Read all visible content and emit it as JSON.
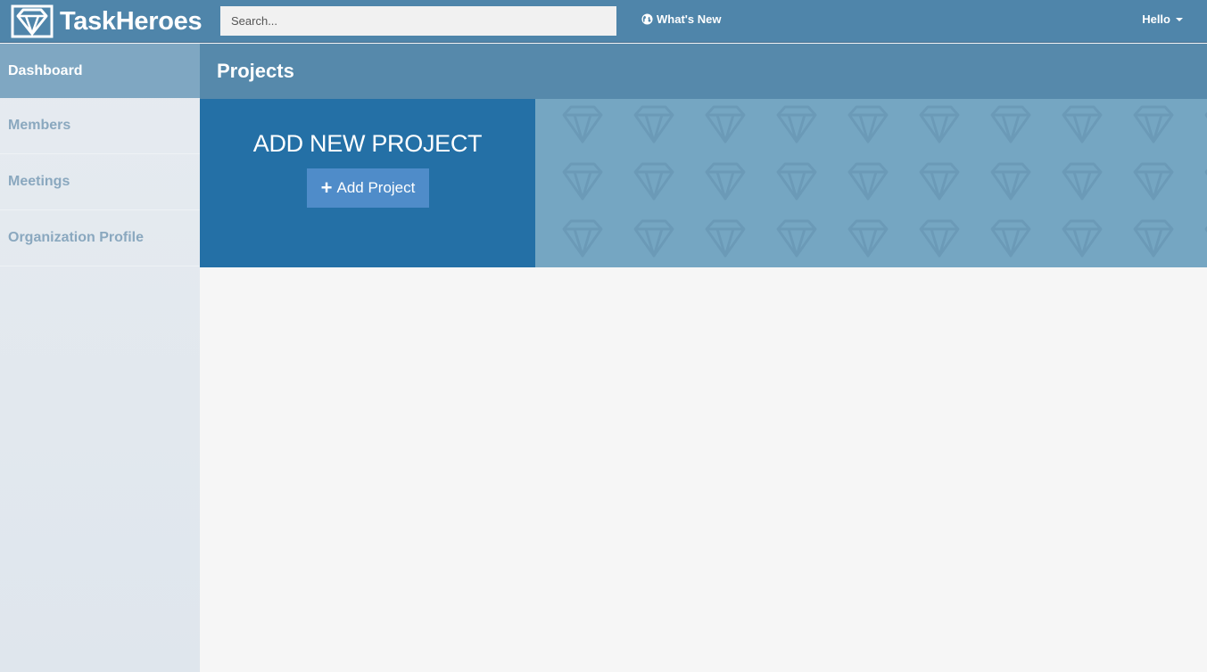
{
  "app": {
    "name": "TaskHeroes"
  },
  "header": {
    "search_placeholder": "Search...",
    "whats_new_label": "What's New",
    "user_label": "Hello"
  },
  "sidebar": {
    "items": [
      {
        "label": "Dashboard",
        "active": true
      },
      {
        "label": "Members",
        "active": false
      },
      {
        "label": "Meetings",
        "active": false
      },
      {
        "label": "Organization Profile",
        "active": false
      }
    ]
  },
  "main": {
    "title": "Projects",
    "add_panel": {
      "heading": "ADD NEW PROJECT",
      "button_label": "Add Project"
    }
  },
  "icons": {
    "logo": "diamond-logo-icon",
    "globe": "globe-icon",
    "plus": "plus-icon",
    "caret": "caret-down-icon"
  },
  "colors": {
    "topbar": "#4f85aa",
    "sidebar_active": "#7fa7c2",
    "panel_dark": "#2470a6",
    "panel_light": "#75a6c2",
    "button": "#4f8cc9"
  }
}
